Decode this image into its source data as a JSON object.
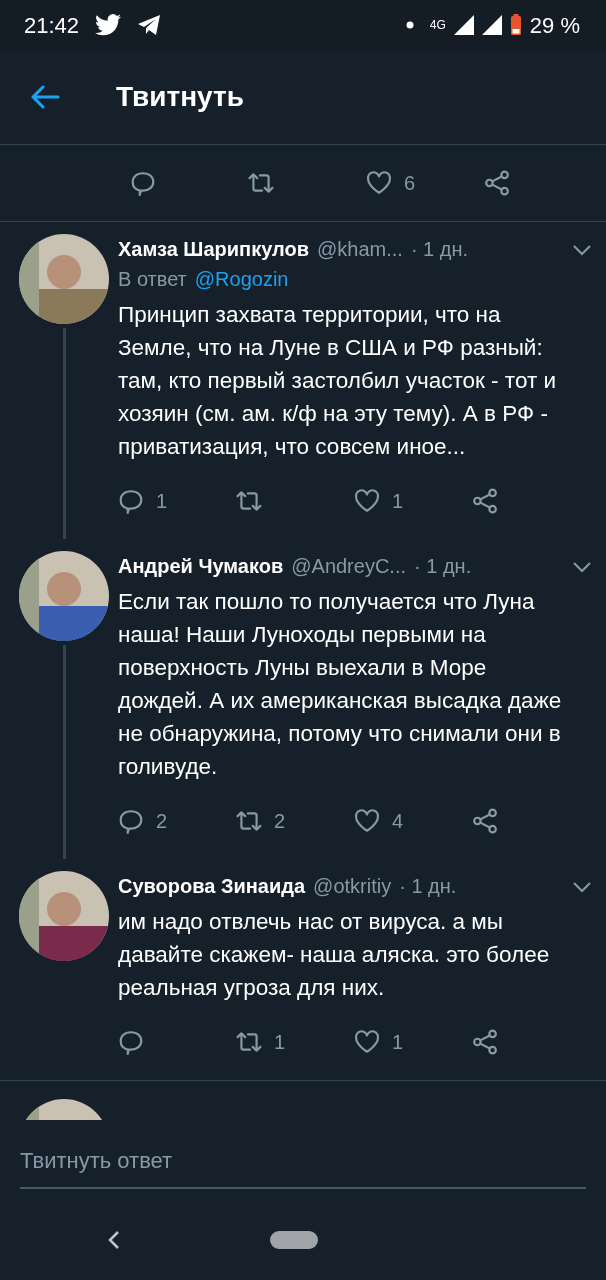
{
  "status_bar": {
    "time": "21:42",
    "network": "4G",
    "battery": "29 %"
  },
  "header": {
    "title": "Твитнуть"
  },
  "tweets": [
    {
      "kind": "actions_only",
      "counts": {
        "like": "6"
      }
    },
    {
      "kind": "tweet",
      "author": "Хамза Шарипкулов",
      "handle": "@kham...",
      "time": "· 1 дн.",
      "reply_label": "В ответ",
      "reply_to": "@Rogozin",
      "text": "Принцип захвата территории, что на Земле, что на Луне в США и РФ разный: там, кто первый застолбил участок - тот и хозяин (см. ам. к/ф на эту тему). А в РФ - приватизация, что совсем иное...",
      "thread_line": true,
      "counts": {
        "reply": "1",
        "like": "1"
      }
    },
    {
      "kind": "tweet",
      "author": "Андрей Чумаков",
      "handle": "@AndreyC...",
      "time": "· 1 дн.",
      "text": "Если так пошло то получается что Луна наша! Наши Луноходы первыми на поверхность Луны выехали в Море дождей. А их американская высадка даже не обнаружина, потому что снимали они в голивуде.",
      "thread_line": true,
      "counts": {
        "reply": "2",
        "retweet": "2",
        "like": "4"
      }
    },
    {
      "kind": "tweet",
      "author": "Суворова Зинаида",
      "handle": "@otkritiy",
      "time": "· 1 дн.",
      "text": "им надо отвлечь нас от вируса. а мы давайте скажем- наша аляска. это более реальная угроза для них.",
      "thread_line": false,
      "counts": {
        "retweet": "1",
        "like": "1"
      }
    },
    {
      "kind": "cut"
    }
  ],
  "reply_field": {
    "placeholder": "Твитнуть ответ"
  }
}
